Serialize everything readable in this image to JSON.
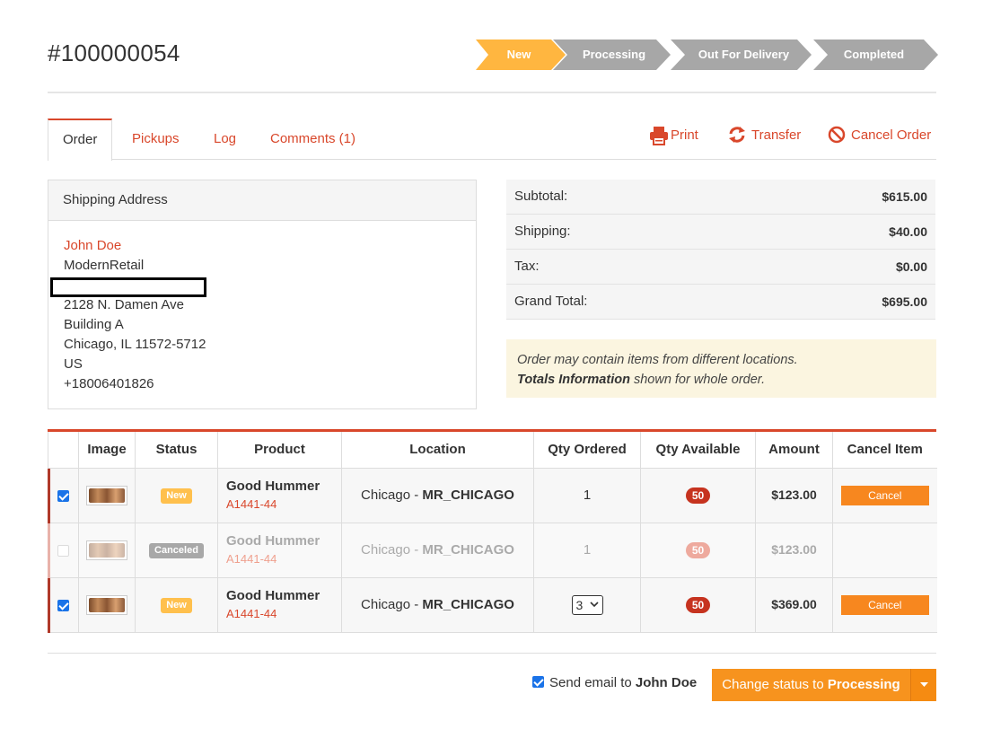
{
  "order": {
    "number": "#100000054"
  },
  "status_steps": [
    {
      "label": "New",
      "active": true
    },
    {
      "label": "Processing",
      "active": false
    },
    {
      "label": "Out For Delivery",
      "active": false
    },
    {
      "label": "Completed",
      "active": false
    }
  ],
  "colors": {
    "accent": "#d9472b",
    "step_active": "#ffb640",
    "step_inactive": "#a7a7a7",
    "button": "#f7931e"
  },
  "tabs": [
    {
      "label": "Order",
      "active": true
    },
    {
      "label": "Pickups",
      "active": false
    },
    {
      "label": "Log",
      "active": false
    },
    {
      "label": "Comments (1)",
      "active": false
    }
  ],
  "actions": {
    "print": {
      "label": "Print",
      "icon": "printer-icon"
    },
    "transfer": {
      "label": "Transfer",
      "icon": "refresh-icon"
    },
    "cancel_order": {
      "label": "Cancel Order",
      "icon": "ban-icon"
    }
  },
  "shipping": {
    "title": "Shipping Address",
    "name": "John Doe",
    "company": "ModernRetail",
    "street": "2128 N. Damen Ave",
    "building": "Building A",
    "city": "Chicago, IL 11572-5712",
    "country": "US",
    "phone": "+18006401826"
  },
  "totals": {
    "subtotal_label": "Subtotal:",
    "subtotal": "$615.00",
    "shipping_label": "Shipping:",
    "shipping": "$40.00",
    "tax_label": "Tax:",
    "tax": "$0.00",
    "grand_label": "Grand Total:",
    "grand": "$695.00"
  },
  "note": {
    "line1": "Order may contain items from different locations.",
    "bold": "Totals Information",
    "line2_rest": " shown for whole order."
  },
  "table": {
    "headers": [
      "Image",
      "Status",
      "Product",
      "Location",
      "Qty Ordered",
      "Qty Available",
      "Amount",
      "Cancel Item"
    ],
    "rows": [
      {
        "checked": true,
        "status": "New",
        "product": "Good Hummer",
        "sku": "A1441-44",
        "city": "Chicago - ",
        "location": "MR_CHICAGO",
        "qty": "1",
        "available": "50",
        "amount": "$123.00",
        "cancel": "Cancel"
      },
      {
        "checked": false,
        "status": "Canceled",
        "product": "Good Hummer",
        "sku": "A1441-44",
        "city": "Chicago - ",
        "location": "MR_CHICAGO",
        "qty": "1",
        "available": "50",
        "amount": "$123.00",
        "cancel": ""
      },
      {
        "checked": true,
        "status": "New",
        "product": "Good Hummer",
        "sku": "A1441-44",
        "city": "Chicago - ",
        "location": "MR_CHICAGO",
        "qty": "3",
        "available": "50",
        "amount": "$369.00",
        "cancel": "Cancel"
      }
    ]
  },
  "footer": {
    "email_prefix": "Send email to ",
    "email_name": "John Doe",
    "email_checked": true,
    "change_prefix": "Change status to ",
    "change_status": "Processing"
  }
}
